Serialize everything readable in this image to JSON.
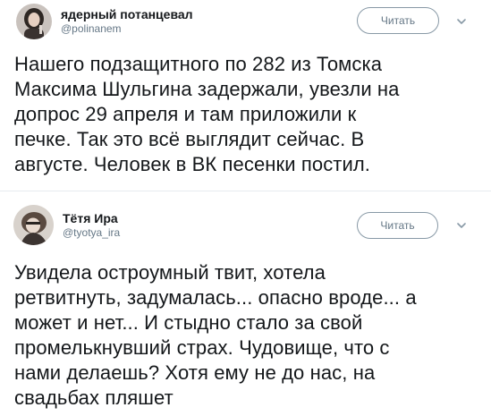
{
  "tweets": [
    {
      "author": {
        "name": "ядерный потанцевал",
        "handle": "@polinanem"
      },
      "follow_label": "Читать",
      "text": "Нашего подзащитного по 282 из Томска\nМаксима Шульгина задержали, увезли на\nдопрос 29 апреля и там приложили к\nпечке. Так это всё выглядит сейчас. В\nавгусте. Человек в ВК песенки постил."
    },
    {
      "author": {
        "name": "Тётя Ира",
        "handle": "@tyotya_ira"
      },
      "follow_label": "Читать",
      "text": "Увидела остроумный твит, хотела\nретвитнуть, задумалась... опасно вроде... а\nможет и нет... И стыдно стало за свой\nпромелькнувший страх. Чудовище, что с\nнами делаешь? Хотя ему не до нас, на\nсвадьбах пляшет"
    }
  ],
  "icons": {
    "caret": "chevron-down-icon",
    "avatar": "avatar"
  },
  "colors": {
    "text": "#14171a",
    "secondary": "#657786",
    "button_border": "#8899a6",
    "divider": "#e6ecf0"
  }
}
